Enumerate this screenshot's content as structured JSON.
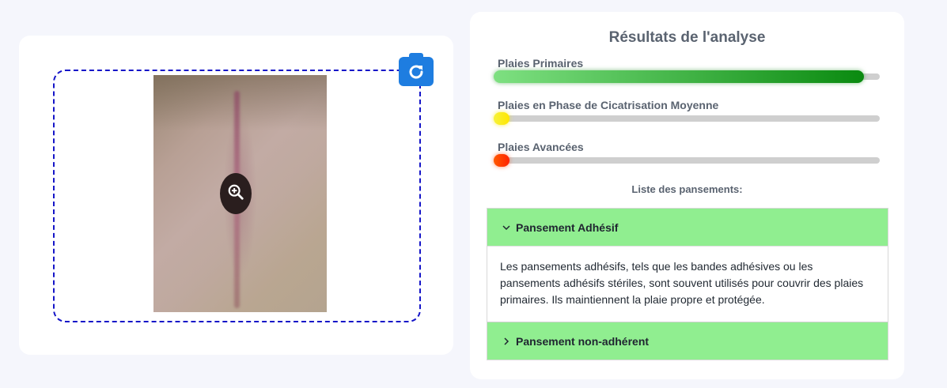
{
  "analysis": {
    "title": "Résultats de l'analyse",
    "categories": [
      {
        "label": "Plaies Primaires",
        "value_percent": 96,
        "color": "#0a8a10"
      },
      {
        "label": "Plaies en Phase de Cicatrisation Moyenne",
        "value_percent": 3,
        "color": "#ffe600"
      },
      {
        "label": "Plaies Avancées",
        "value_percent": 4,
        "color": "#ff3300"
      }
    ],
    "dressings_heading": "Liste des pansements:",
    "dressings": [
      {
        "title": "Pansement Adhésif",
        "expanded": true,
        "description": "Les pansements adhésifs, tels que les bandes adhésives ou les pansements adhésifs stériles, sont souvent utilisés pour couvrir des plaies primaires. Ils maintiennent la plaie propre et protégée."
      },
      {
        "title": "Pansement non-adhérent",
        "expanded": false
      }
    ]
  },
  "upload": {
    "camera_icon": "camera-rotate-icon",
    "zoom_icon": "zoom-in-icon"
  },
  "colors": {
    "accordion_header": "#90ee90",
    "drop_zone_border": "#1515c8",
    "camera_button": "#1e7de0"
  }
}
